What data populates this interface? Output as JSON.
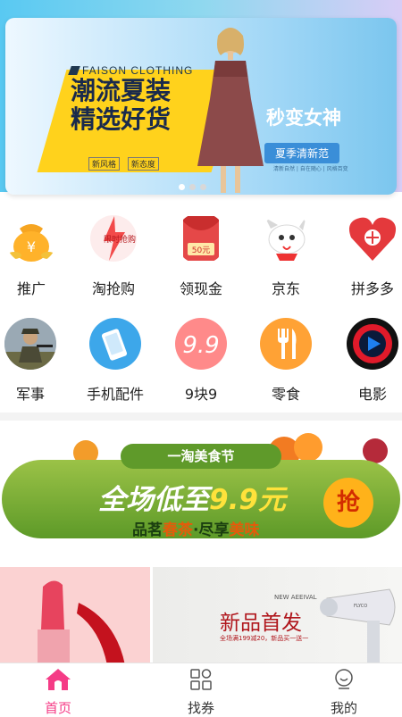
{
  "banner": {
    "brand": "FAISON CLOTHING",
    "slogan_line1": "潮流夏装",
    "slogan_line2": "精选好货",
    "tag1": "新风格",
    "tag2": "新态度",
    "headline": "秒变女神",
    "pill": "夏季清新范",
    "sub": "清新自然 | 自在随心 | 风格百变",
    "dots_total": 3,
    "dots_active": 1
  },
  "categories_row1": [
    {
      "label": "推广",
      "icon": "money-bag-icon"
    },
    {
      "label": "淘抢购",
      "icon": "flash-sale-icon"
    },
    {
      "label": "领现金",
      "icon": "red-envelope-icon"
    },
    {
      "label": "京东",
      "icon": "jd-dog-icon"
    },
    {
      "label": "拼多多",
      "icon": "pinduoduo-heart-icon"
    }
  ],
  "categories_row2": [
    {
      "label": "军事",
      "icon": "soldier-avatar-icon"
    },
    {
      "label": "手机配件",
      "icon": "phone-icon"
    },
    {
      "label": "9块9",
      "icon": "nine-point-nine-icon"
    },
    {
      "label": "零食",
      "icon": "fork-knife-icon"
    },
    {
      "label": "电影",
      "icon": "movie-play-icon"
    }
  ],
  "cat_icons": {
    "red_envelope_amount": "50元",
    "flash_text": "限时抢购",
    "nine": "9.9"
  },
  "promo": {
    "tab": "一淘美食节",
    "big_prefix": "全场低至",
    "big_value": "9.9元",
    "small_a": "品茗",
    "small_b": "春茶",
    "small_c": "·尽享",
    "small_d": "美味",
    "grab": "抢"
  },
  "lower": {
    "title": "新品首发",
    "eyebrow": "NEW AEEIVAL",
    "sub": "全场满199减20，新品买一送一"
  },
  "tabbar": [
    {
      "label": "首页",
      "icon": "home-icon",
      "active": true
    },
    {
      "label": "找券",
      "icon": "grid-icon",
      "active": false
    },
    {
      "label": "我的",
      "icon": "profile-icon",
      "active": false
    }
  ],
  "colors": {
    "accent": "#f53b86",
    "banner_yellow": "#ffd21c",
    "promo_green": "#5f9a2a"
  }
}
